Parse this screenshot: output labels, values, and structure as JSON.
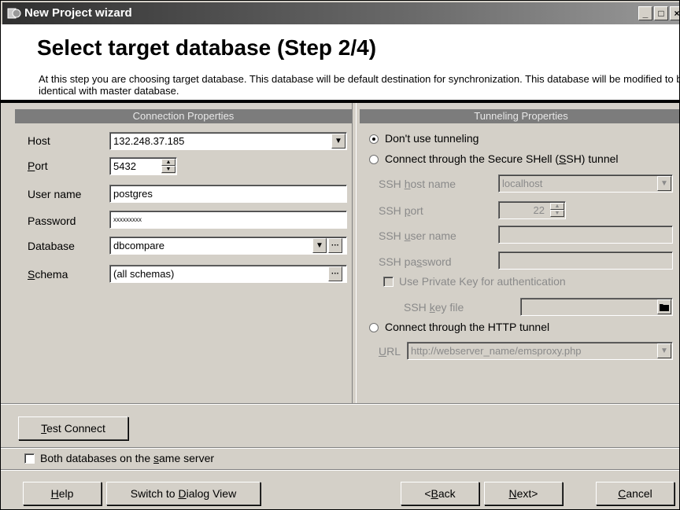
{
  "window": {
    "title": "New Project wizard",
    "minimize": "_",
    "maximize": "□",
    "close": "×"
  },
  "header": {
    "title": "Select target database (Step 2/4)",
    "description": "At this step you are choosing target database. This database will be default destination for synchronization. This database will be modified to be identical with master database."
  },
  "connection": {
    "section_title": "Connection Properties",
    "host": {
      "label": "Host",
      "value": "132.248.37.185"
    },
    "port": {
      "label_u": "P",
      "label_rest": "ort",
      "value": "5432"
    },
    "user": {
      "label": "User name",
      "value": "postgres"
    },
    "password": {
      "label": "Password",
      "value": "xxxxxxxxx"
    },
    "database": {
      "label": "Database",
      "value": "dbcompare"
    },
    "schema": {
      "label_u": "S",
      "label_rest": "chema",
      "value": "(all schemas)"
    },
    "ellipsis": "···"
  },
  "tunneling": {
    "section_title": "Tunneling Properties",
    "no_tunnel": "Don't use tunneling",
    "ssh_tunnel_a": "Connect through the Secure SHell (",
    "ssh_tunnel_u": "S",
    "ssh_tunnel_b": "SH) tunnel",
    "ssh_host": {
      "label_a": "SSH ",
      "label_u": "h",
      "label_b": "ost name",
      "value": "localhost"
    },
    "ssh_port": {
      "label_a": "SSH ",
      "label_u": "p",
      "label_b": "ort",
      "value": "22"
    },
    "ssh_user": {
      "label_a": "SSH ",
      "label_u": "u",
      "label_b": "ser name",
      "value": ""
    },
    "ssh_password": {
      "label_a": "SSH pa",
      "label_u": "s",
      "label_b": "sword",
      "value": ""
    },
    "private_key": "Use Private Key for authentication",
    "key_file": {
      "label_a": "SSH ",
      "label_u": "k",
      "label_b": "ey file",
      "value": ""
    },
    "http_tunnel": "Connect through the HTTP tunnel",
    "url": {
      "label_a": "",
      "label_u": "U",
      "label_b": "RL",
      "value": "http://webserver_name/emsproxy.php"
    }
  },
  "test_connect": {
    "u": "T",
    "rest": "est Connect"
  },
  "same_server": {
    "a": "Both databases on the ",
    "u": "s",
    "b": "ame server"
  },
  "footer": {
    "help": {
      "u": "H",
      "rest": "elp"
    },
    "switch": {
      "a": "Switch to ",
      "u": "D",
      "b": "ialog View"
    },
    "back": {
      "a": "<",
      "u": "B",
      "b": "ack"
    },
    "next": {
      "u": "N",
      "b": "ext>"
    },
    "cancel": {
      "u": "C",
      "b": "ancel"
    }
  },
  "colors": {
    "panel_header": "#7c7c7c",
    "dialog": "#d4d0c8"
  }
}
